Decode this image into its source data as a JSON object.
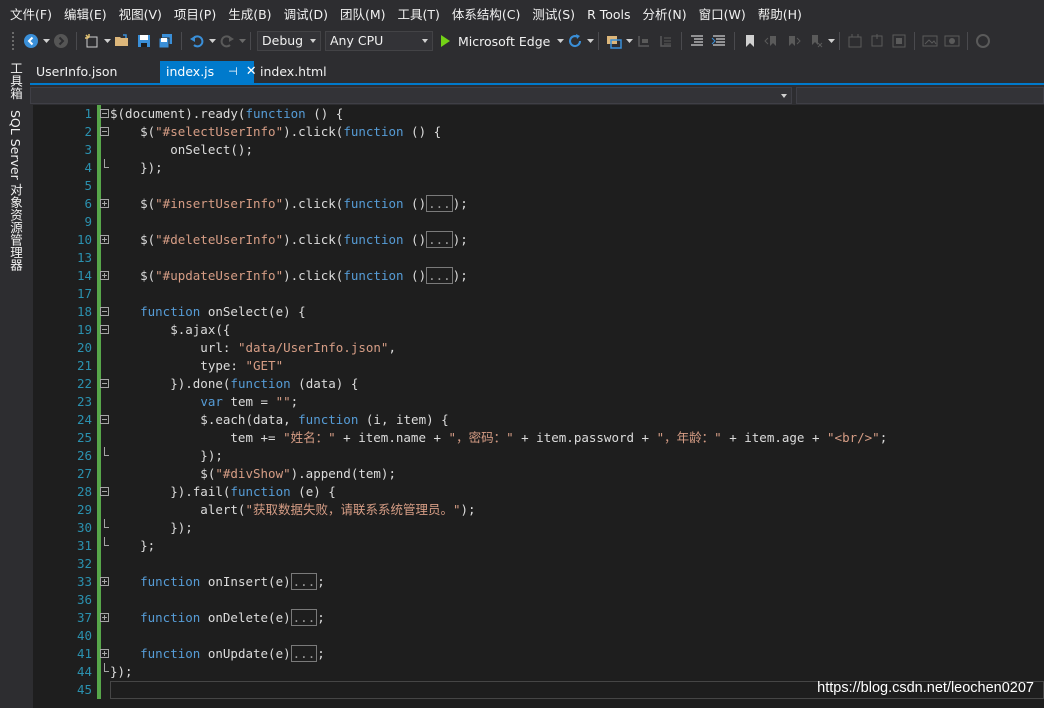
{
  "menu": [
    "文件(F)",
    "编辑(E)",
    "视图(V)",
    "项目(P)",
    "生成(B)",
    "调试(D)",
    "团队(M)",
    "工具(T)",
    "体系结构(C)",
    "测试(S)",
    "R Tools",
    "分析(N)",
    "窗口(W)",
    "帮助(H)"
  ],
  "toolbar": {
    "config": "Debug",
    "platform": "Any CPU",
    "run_target": "Microsoft Edge"
  },
  "side_tabs": [
    "工具箱",
    "SQL Server 对象资源管理器"
  ],
  "tabs": [
    {
      "label": "UserInfo.json"
    },
    {
      "label": "index.js",
      "pin": "⊣",
      "close": "✕"
    },
    {
      "label": "index.html"
    }
  ],
  "editor": {
    "lines": [
      {
        "n": "1",
        "fold": "open",
        "parts": [
          [
            "t",
            "$(document).ready("
          ],
          [
            "k",
            "function"
          ],
          [
            "t",
            " () {"
          ]
        ]
      },
      {
        "n": "2",
        "fold": "open",
        "parts": [
          [
            "t",
            "    $("
          ],
          [
            "s",
            "\"#selectUserInfo\""
          ],
          [
            "t",
            ").click("
          ],
          [
            "k",
            "function"
          ],
          [
            "t",
            " () {"
          ]
        ]
      },
      {
        "n": "3",
        "parts": [
          [
            "t",
            "        onSelect();"
          ]
        ]
      },
      {
        "n": "4",
        "fold": "end",
        "parts": [
          [
            "t",
            "    });"
          ]
        ]
      },
      {
        "n": "5",
        "parts": []
      },
      {
        "n": "6",
        "fold": "closed",
        "parts": [
          [
            "t",
            "    $("
          ],
          [
            "s",
            "\"#insertUserInfo\""
          ],
          [
            "t",
            ").click("
          ],
          [
            "k",
            "function"
          ],
          [
            "t",
            " ()"
          ],
          [
            "p",
            "..."
          ],
          [
            "t",
            ");"
          ]
        ]
      },
      {
        "n": "9",
        "parts": []
      },
      {
        "n": "10",
        "fold": "closed",
        "parts": [
          [
            "t",
            "    $("
          ],
          [
            "s",
            "\"#deleteUserInfo\""
          ],
          [
            "t",
            ").click("
          ],
          [
            "k",
            "function"
          ],
          [
            "t",
            " ()"
          ],
          [
            "p",
            "..."
          ],
          [
            "t",
            ");"
          ]
        ]
      },
      {
        "n": "13",
        "parts": []
      },
      {
        "n": "14",
        "fold": "closed",
        "parts": [
          [
            "t",
            "    $("
          ],
          [
            "s",
            "\"#updateUserInfo\""
          ],
          [
            "t",
            ").click("
          ],
          [
            "k",
            "function"
          ],
          [
            "t",
            " ()"
          ],
          [
            "p",
            "..."
          ],
          [
            "t",
            ");"
          ]
        ]
      },
      {
        "n": "17",
        "parts": []
      },
      {
        "n": "18",
        "fold": "open",
        "parts": [
          [
            "t",
            "    "
          ],
          [
            "k",
            "function"
          ],
          [
            "t",
            " onSelect(e) {"
          ]
        ]
      },
      {
        "n": "19",
        "fold": "open",
        "parts": [
          [
            "t",
            "        $.ajax({"
          ]
        ]
      },
      {
        "n": "20",
        "parts": [
          [
            "t",
            "            url: "
          ],
          [
            "s",
            "\"data/UserInfo.json\""
          ],
          [
            "t",
            ","
          ]
        ]
      },
      {
        "n": "21",
        "parts": [
          [
            "t",
            "            type: "
          ],
          [
            "s",
            "\"GET\""
          ]
        ]
      },
      {
        "n": "22",
        "fold": "open",
        "parts": [
          [
            "t",
            "        }).done("
          ],
          [
            "k",
            "function"
          ],
          [
            "t",
            " (data) {"
          ]
        ]
      },
      {
        "n": "23",
        "parts": [
          [
            "t",
            "            "
          ],
          [
            "k",
            "var"
          ],
          [
            "t",
            " tem = "
          ],
          [
            "s",
            "\"\""
          ],
          [
            "t",
            ";"
          ]
        ]
      },
      {
        "n": "24",
        "fold": "open",
        "parts": [
          [
            "t",
            "            $.each(data, "
          ],
          [
            "k",
            "function"
          ],
          [
            "t",
            " (i, item) {"
          ]
        ]
      },
      {
        "n": "25",
        "parts": [
          [
            "t",
            "                tem += "
          ],
          [
            "s",
            "\"姓名：\""
          ],
          [
            "t",
            " + item.name + "
          ],
          [
            "s",
            "\"，密码：\""
          ],
          [
            "t",
            " + item.password + "
          ],
          [
            "s",
            "\"，年龄：\""
          ],
          [
            "t",
            " + item.age + "
          ],
          [
            "s",
            "\"<br/>\""
          ],
          [
            "t",
            ";"
          ]
        ]
      },
      {
        "n": "26",
        "fold": "end",
        "parts": [
          [
            "t",
            "            });"
          ]
        ]
      },
      {
        "n": "27",
        "parts": [
          [
            "t",
            "            $("
          ],
          [
            "s",
            "\"#divShow\""
          ],
          [
            "t",
            ").append(tem);"
          ]
        ]
      },
      {
        "n": "28",
        "fold": "open",
        "parts": [
          [
            "t",
            "        }).fail("
          ],
          [
            "k",
            "function"
          ],
          [
            "t",
            " (e) {"
          ]
        ]
      },
      {
        "n": "29",
        "parts": [
          [
            "t",
            "            alert("
          ],
          [
            "s",
            "\"获取数据失败，请联系系统管理员。\""
          ],
          [
            "t",
            ");"
          ]
        ]
      },
      {
        "n": "30",
        "fold": "end",
        "parts": [
          [
            "t",
            "        });"
          ]
        ]
      },
      {
        "n": "31",
        "fold": "end",
        "parts": [
          [
            "t",
            "    };"
          ]
        ]
      },
      {
        "n": "32",
        "parts": []
      },
      {
        "n": "33",
        "fold": "closed",
        "parts": [
          [
            "t",
            "    "
          ],
          [
            "k",
            "function"
          ],
          [
            "t",
            " onInsert(e)"
          ],
          [
            "p",
            "..."
          ],
          [
            "t",
            ";"
          ]
        ]
      },
      {
        "n": "36",
        "parts": []
      },
      {
        "n": "37",
        "fold": "closed",
        "parts": [
          [
            "t",
            "    "
          ],
          [
            "k",
            "function"
          ],
          [
            "t",
            " onDelete(e)"
          ],
          [
            "p",
            "..."
          ],
          [
            "t",
            ";"
          ]
        ]
      },
      {
        "n": "40",
        "parts": []
      },
      {
        "n": "41",
        "fold": "closed",
        "parts": [
          [
            "t",
            "    "
          ],
          [
            "k",
            "function"
          ],
          [
            "t",
            " onUpdate(e)"
          ],
          [
            "p",
            "..."
          ],
          [
            "t",
            ";"
          ]
        ]
      },
      {
        "n": "44",
        "fold": "end",
        "parts": [
          [
            "t",
            "});"
          ]
        ]
      },
      {
        "n": "45",
        "parts": []
      }
    ]
  },
  "watermark": "https://blog.csdn.net/leochen0207",
  "colors": {
    "keyword": "#569cd6",
    "string": "#d69d85",
    "line_number": "#2b91af",
    "change_bar": "#57a64a",
    "accent": "#007acc"
  }
}
